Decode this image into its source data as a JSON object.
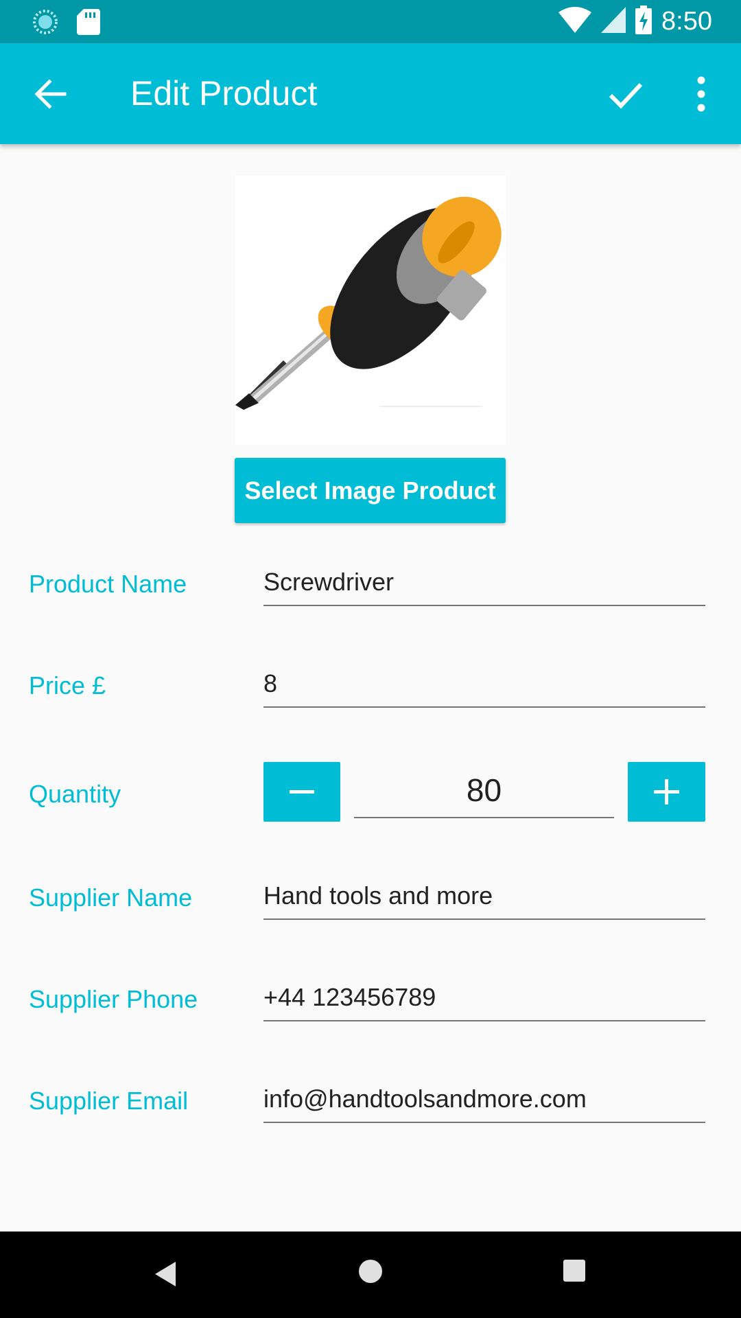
{
  "status_bar": {
    "time": "8:50",
    "icons": [
      "sync-icon",
      "sd-card-icon",
      "wifi-icon",
      "signal-icon",
      "battery-charging-icon"
    ]
  },
  "app_bar": {
    "title": "Edit Product",
    "back_icon": "arrow-back-icon",
    "save_icon": "check-icon",
    "menu_icon": "more-vert-icon"
  },
  "product": {
    "image_alt": "screwdriver-image",
    "select_image_label": "Select Image Product"
  },
  "form": {
    "product_name": {
      "label": "Product Name",
      "value": "Screwdriver"
    },
    "price": {
      "label": "Price £",
      "value": "8"
    },
    "quantity": {
      "label": "Quantity",
      "value": "80",
      "decrement_icon": "minus-icon",
      "increment_icon": "plus-icon"
    },
    "supplier_name": {
      "label": "Supplier Name",
      "value": "Hand tools and more"
    },
    "supplier_phone": {
      "label": "Supplier Phone",
      "value": "+44 123456789"
    },
    "supplier_email": {
      "label": "Supplier Email",
      "value": "info@handtoolsandmore.com"
    }
  },
  "colors": {
    "primary": "#00bcd4",
    "primary_dark": "#0097a7",
    "text": "#212121",
    "underline": "#757575",
    "background": "#fafafa"
  },
  "nav_bar": {
    "icons": [
      "nav-back-icon",
      "nav-home-icon",
      "nav-recents-icon"
    ]
  }
}
